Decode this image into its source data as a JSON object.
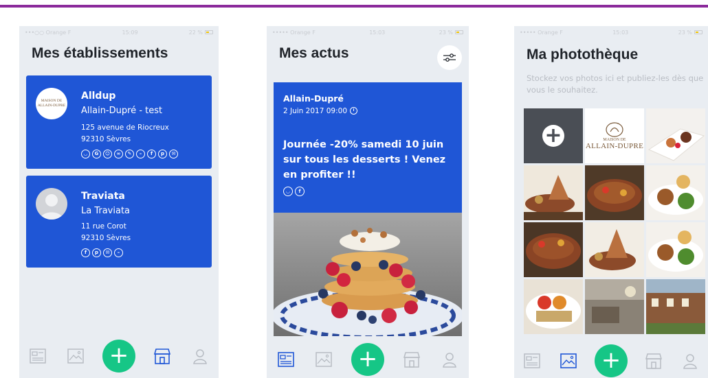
{
  "accent_color": "#1f56d6",
  "fab_color": "#16c686",
  "screen1": {
    "status": {
      "carrier": "•••○○ Orange F",
      "time": "15:09",
      "battery": "22 %"
    },
    "title": "Mes établissements",
    "cards": [
      {
        "avatar_logo": [
          "MAISON DE",
          "ALLAIN-DUPRE"
        ],
        "name": "Alldup",
        "subname": "Allain-Dupré - test",
        "address_line1": "125 avenue de Riocreux",
        "address_line2": "92310 Sèvres",
        "networks": [
          "◡",
          "G",
          "☺",
          "∞",
          "✎",
          "–",
          "f",
          "p",
          "✉"
        ]
      },
      {
        "name": "Traviata",
        "subname": "La Traviata",
        "address_line1": "11 rue Corot",
        "address_line2": "92310 Sèvres",
        "networks": [
          "f",
          "p",
          "✉",
          "–"
        ]
      }
    ]
  },
  "screen2": {
    "status": {
      "carrier": "••••• Orange F",
      "time": "15:03",
      "battery": "23 %"
    },
    "title": "Mes actus",
    "post": {
      "author": "Allain-Dupré",
      "date": "2 Juin 2017 09:00",
      "text": "Journée -20% samedi 10 juin sur tous les desserts ! Venez en profiter !!",
      "networks": [
        "◡",
        "f"
      ]
    }
  },
  "screen3": {
    "status": {
      "carrier": "••••• Orange F",
      "time": "15:03",
      "battery": "23 %"
    },
    "title": "Ma photothèque",
    "description": "Stockez vos photos ici et publiez-les dès que vous le souhaitez.",
    "add_symbol": "+",
    "logo_text": [
      "MAISON DE",
      "ALLAIN-DUPRE"
    ]
  },
  "tabbar": {
    "fab_symbol": "+"
  }
}
